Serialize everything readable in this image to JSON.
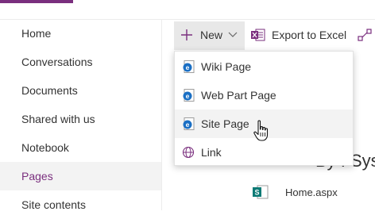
{
  "nav": {
    "items": [
      {
        "label": "Home"
      },
      {
        "label": "Conversations"
      },
      {
        "label": "Documents"
      },
      {
        "label": "Shared with us"
      },
      {
        "label": "Notebook"
      },
      {
        "label": "Pages",
        "active": true
      },
      {
        "label": "Site contents"
      }
    ]
  },
  "toolbar": {
    "new_label": "New",
    "export_label": "Export to Excel"
  },
  "menu": {
    "items": [
      {
        "label": "Wiki Page",
        "icon": "ie-page-icon"
      },
      {
        "label": "Web Part Page",
        "icon": "ie-page-icon"
      },
      {
        "label": "Site Page",
        "icon": "ie-page-icon",
        "hovered": true
      },
      {
        "label": "Link",
        "icon": "globe-icon"
      }
    ]
  },
  "background": {
    "heading_fragment": "By : Syst",
    "file_name": "Home.aspx"
  },
  "colors": {
    "accent": "#7a2f7e",
    "ie_blue": "#1a6fc4",
    "excel_green": "#1d7044"
  }
}
